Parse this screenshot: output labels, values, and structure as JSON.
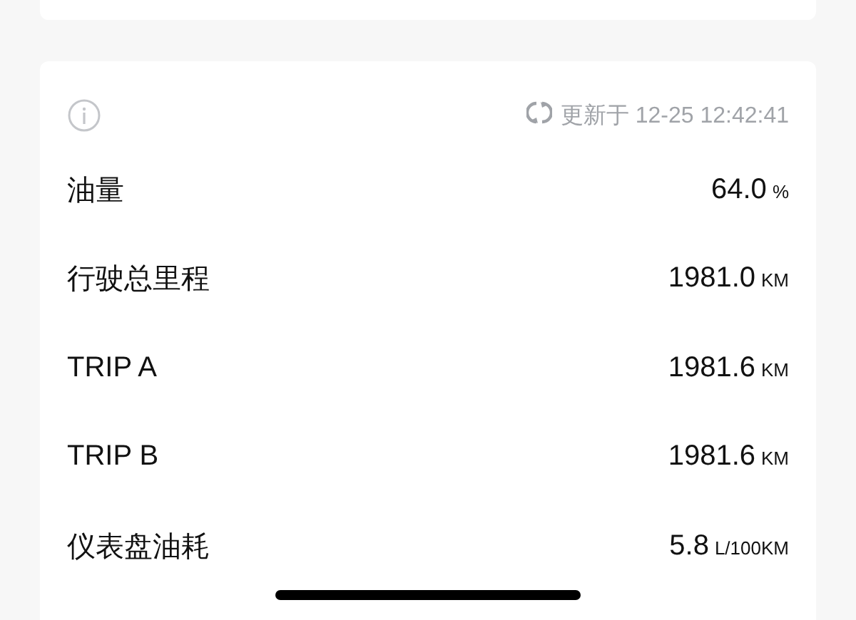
{
  "header": {
    "updated": "更新于 12-25 12:42:41"
  },
  "metrics": [
    {
      "label": "油量",
      "value": "64.0",
      "unit": "%"
    },
    {
      "label": "行驶总里程",
      "value": "1981.0",
      "unit": "KM"
    },
    {
      "label": "TRIP A",
      "value": "1981.6",
      "unit": "KM"
    },
    {
      "label": "TRIP B",
      "value": "1981.6",
      "unit": "KM"
    },
    {
      "label": "仪表盘油耗",
      "value": "5.8",
      "unit": "L/100KM"
    }
  ]
}
